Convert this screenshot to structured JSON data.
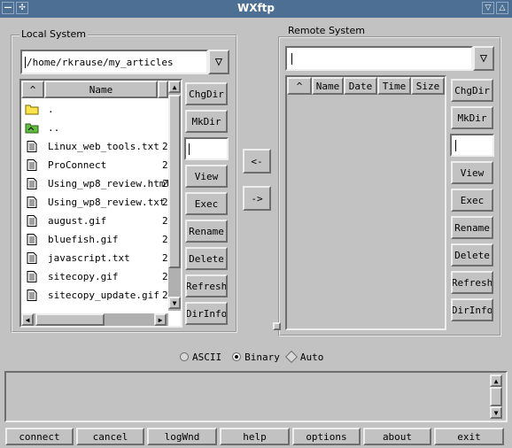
{
  "window": {
    "title": "WXftp"
  },
  "local": {
    "legend": "Local System",
    "path": "/home/rkrause/my_articles",
    "header": {
      "sort": "^",
      "name": "Name"
    },
    "files": [
      {
        "name": ".",
        "icon": "folder-icon"
      },
      {
        "name": "..",
        "icon": "parent-folder-icon"
      },
      {
        "name": "Linux_web_tools.txt",
        "icon": "file-icon"
      },
      {
        "name": "ProConnect",
        "icon": "file-icon"
      },
      {
        "name": "Using_wp8_review.html",
        "icon": "file-icon"
      },
      {
        "name": "Using_wp8_review.txt",
        "icon": "file-icon"
      },
      {
        "name": "august.gif",
        "icon": "file-icon"
      },
      {
        "name": "bluefish.gif",
        "icon": "file-icon"
      },
      {
        "name": "javascript.txt",
        "icon": "file-icon"
      },
      {
        "name": "sitecopy.gif",
        "icon": "file-icon"
      },
      {
        "name": "sitecopy_update.gif",
        "icon": "file-icon"
      }
    ],
    "size_col_glyph": "2",
    "buttons": {
      "chgdir": "ChgDir",
      "mkdir": "MkDir",
      "view": "View",
      "exec": "Exec",
      "rename": "Rename",
      "delete": "Delete",
      "refresh": "Refresh",
      "dirinfo": "DirInfo"
    }
  },
  "transfer": {
    "to_local": "<-",
    "to_remote": "->"
  },
  "remote": {
    "legend": "Remote System",
    "path": "",
    "headers": {
      "sort": "^",
      "name": "Name",
      "date": "Date",
      "time": "Time",
      "size": "Size"
    },
    "buttons": {
      "chgdir": "ChgDir",
      "mkdir": "MkDir",
      "view": "View",
      "exec": "Exec",
      "rename": "Rename",
      "delete": "Delete",
      "refresh": "Refresh",
      "dirinfo": "DirInfo"
    }
  },
  "mode": {
    "ascii": "ASCII",
    "binary": "Binary",
    "auto": "Auto",
    "selected": "binary"
  },
  "bottom": {
    "connect": "connect",
    "cancel": "cancel",
    "logwnd": "logWnd",
    "help": "help",
    "options": "options",
    "about": "about",
    "exit": "exit"
  },
  "colors": {
    "titlebar": "#4d6f93",
    "panel": "#c2c2c2"
  }
}
